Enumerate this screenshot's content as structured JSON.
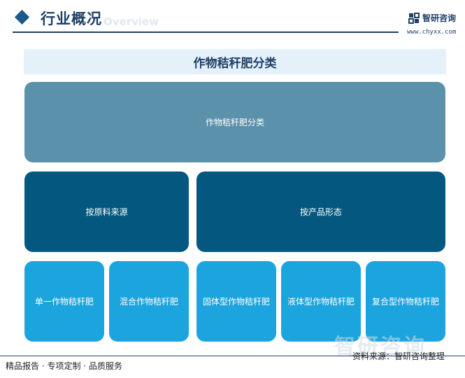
{
  "header": {
    "title": "行业概况",
    "subtitle": "Overview",
    "logo_name": "智研咨询",
    "logo_url": "www.chyxx.com"
  },
  "banner": {
    "title": "作物秸秆肥分类"
  },
  "diagram": {
    "root": "作物秸秆肥分类",
    "groups": [
      {
        "label": "按原料来源",
        "children": [
          "单一作物秸秆肥",
          "混合作物秸秆肥"
        ]
      },
      {
        "label": "按产品形态",
        "children": [
          "固体型作物秸秆肥",
          "液体型作物秸秆肥",
          "复合型作物秸秆肥"
        ]
      }
    ],
    "colors": {
      "root": "#5b91aa",
      "group": "#04587f",
      "leaf": "#1ca4de"
    }
  },
  "footer": {
    "left": "精品报告 · 专项定制 · 品质服务",
    "source": "资料来源：智研咨询整理"
  },
  "watermark": {
    "text": "智研咨询",
    "url": "www.chyxx.com"
  }
}
